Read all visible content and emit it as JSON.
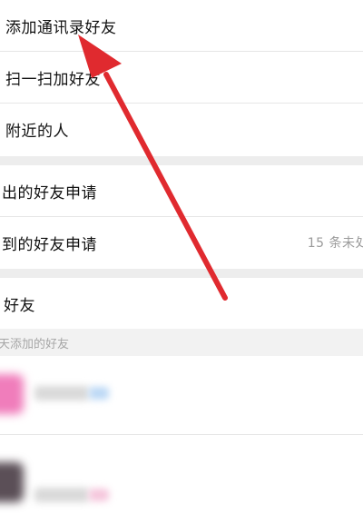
{
  "menu": {
    "add_contacts_label": "添加通讯录好友",
    "scan_label": "扫一扫加好友",
    "nearby_label": "附近的人"
  },
  "requests": {
    "sent_label": "出的好友申请",
    "received_label": "到的好友申请",
    "received_status": "15 条未处"
  },
  "friends": {
    "label": "好友",
    "section_header": "天添加的好友"
  },
  "colors": {
    "arrow": "#e02a2f",
    "avatar1": "#f07dbb",
    "avatar2": "#5b4f57",
    "tag1": "#bcd8f5",
    "tag2": "#f5c6dc"
  }
}
